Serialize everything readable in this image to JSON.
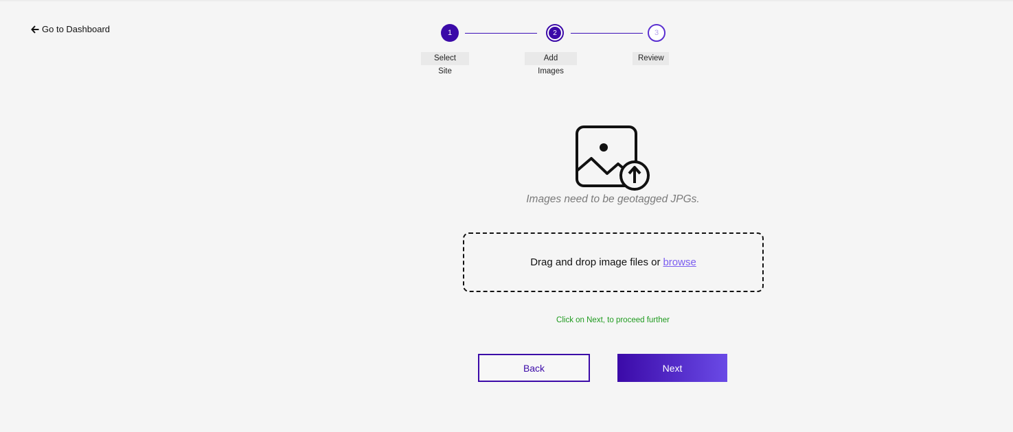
{
  "nav": {
    "back_label": "Go to Dashboard"
  },
  "stepper": {
    "steps": [
      {
        "number": "1",
        "label": "Select Site",
        "state": "completed"
      },
      {
        "number": "2",
        "label": "Add Images",
        "state": "current"
      },
      {
        "number": "3",
        "label": "Review",
        "state": "upcoming"
      }
    ]
  },
  "upload": {
    "icon": "image-upload-icon",
    "hint": "Images need to be geotagged JPGs.",
    "drop_text": "Drag and drop image files or",
    "browse_label": "browse"
  },
  "status": {
    "message": "Click on Next, to proceed further"
  },
  "actions": {
    "back_label": "Back",
    "next_label": "Next"
  },
  "colors": {
    "accent": "#3b0aa8",
    "accent_light": "#6a4ae6",
    "success_text": "#1e9a1e",
    "link": "#7a5cf0",
    "background": "#f5f5f5"
  }
}
